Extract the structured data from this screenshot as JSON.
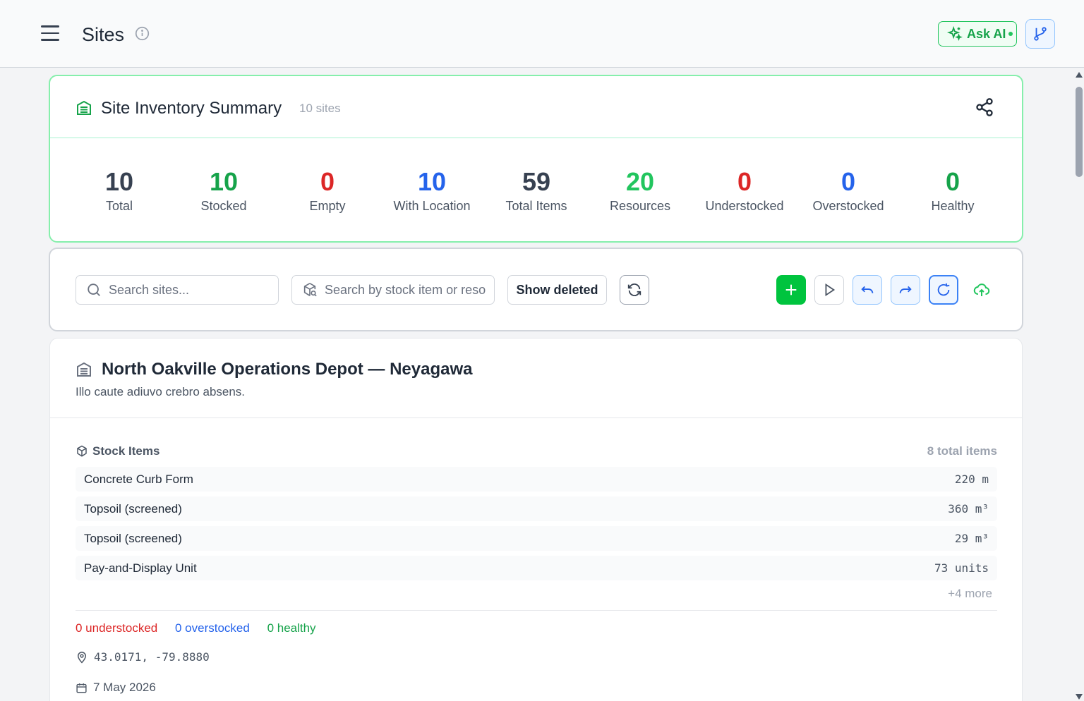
{
  "header": {
    "title": "Sites",
    "ask_ai_label": "Ask AI"
  },
  "summary": {
    "title": "Site Inventory Summary",
    "count": "10 sites",
    "stats": [
      {
        "value": "10",
        "label": "Total",
        "color": "#374151"
      },
      {
        "value": "10",
        "label": "Stocked",
        "color": "#16a34a"
      },
      {
        "value": "0",
        "label": "Empty",
        "color": "#dc2626"
      },
      {
        "value": "10",
        "label": "With Location",
        "color": "#2563eb"
      },
      {
        "value": "59",
        "label": "Total Items",
        "color": "#374151"
      },
      {
        "value": "20",
        "label": "Resources",
        "color": "#22c55e"
      },
      {
        "value": "0",
        "label": "Understocked",
        "color": "#dc2626"
      },
      {
        "value": "0",
        "label": "Overstocked",
        "color": "#2563eb"
      },
      {
        "value": "0",
        "label": "Healthy",
        "color": "#16a34a"
      }
    ]
  },
  "toolbar": {
    "search_sites_placeholder": "Search sites...",
    "search_stock_placeholder": "Search by stock item or reso",
    "show_deleted_label": "Show deleted"
  },
  "site": {
    "title": "North Oakville Operations Depot — Neyagawa",
    "description": "Illo caute adiuvo crebro absens.",
    "stock_header": "Stock Items",
    "stock_count": "8 total items",
    "items": [
      {
        "name": "Concrete Curb Form",
        "qty": "220 m"
      },
      {
        "name": "Topsoil (screened)",
        "qty": "360 m³"
      },
      {
        "name": "Topsoil (screened)",
        "qty": "29 m³"
      },
      {
        "name": "Pay-and-Display Unit",
        "qty": "73 units"
      }
    ],
    "more": "+4 more",
    "understocked": "0 understocked",
    "overstocked": "0 overstocked",
    "healthy": "0 healthy",
    "coords": "43.0171, -79.8880",
    "date": "7 May 2026"
  },
  "colors": {
    "accent_green": "#22c55e",
    "accent_blue": "#3b82f6",
    "danger": "#dc2626"
  }
}
